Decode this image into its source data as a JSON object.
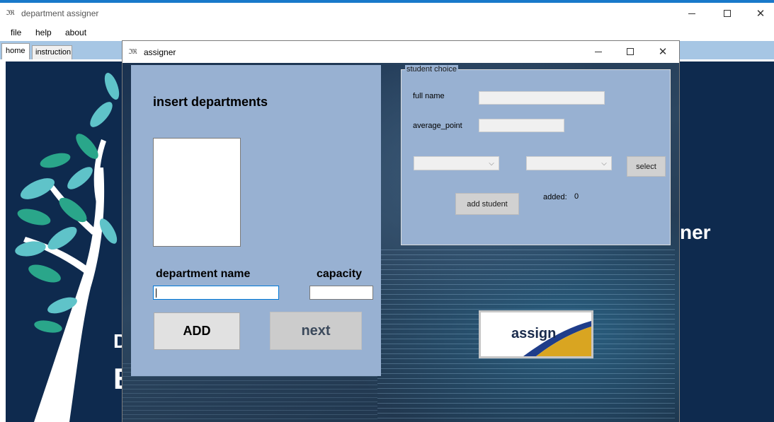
{
  "main_window": {
    "title": "department assigner",
    "icon": "app-icon",
    "icon_glyph": "ℑℜ"
  },
  "window_controls": {
    "minimize": "minimize-icon",
    "maximize": "maximize-icon",
    "close": "close-icon",
    "close_glyph": "✕"
  },
  "menu": {
    "items": [
      {
        "label": "file"
      },
      {
        "label": "help"
      },
      {
        "label": "about"
      }
    ]
  },
  "tabs": [
    {
      "label": "home",
      "selected": true
    },
    {
      "label": "instruction",
      "selected": false
    }
  ],
  "home_banner": {
    "visible_text_fragments": [
      "D",
      "E",
      "ner"
    ]
  },
  "dialog": {
    "title": "assigner",
    "insert_panel": {
      "title": "insert departments",
      "department_name_label": "department name",
      "department_name_value": "",
      "capacity_label": "capacity",
      "capacity_value": "",
      "add_button": "ADD",
      "next_button": "next"
    },
    "student_choice": {
      "legend": "student choice",
      "full_name_label": "full name",
      "full_name_value": "",
      "average_point_label": "average_point",
      "average_point_value": "",
      "choice_1_value": "",
      "choice_2_value": "",
      "combo_arrow_glyph": "⌵",
      "select_button": "select",
      "add_student_button": "add student",
      "added_label": "added:",
      "added_count": "0"
    },
    "assign_button": "assign"
  },
  "colors": {
    "title_accent": "#1979ca",
    "tabstrip": "#a6c6e4",
    "panel": "#98b1d2",
    "banner": "#0e2a4e",
    "leaf_teal": "#5fc3c9",
    "leaf_green": "#2aa68a",
    "assign_logo_blue": "#1f3d8a",
    "assign_logo_gold": "#d9a521"
  }
}
